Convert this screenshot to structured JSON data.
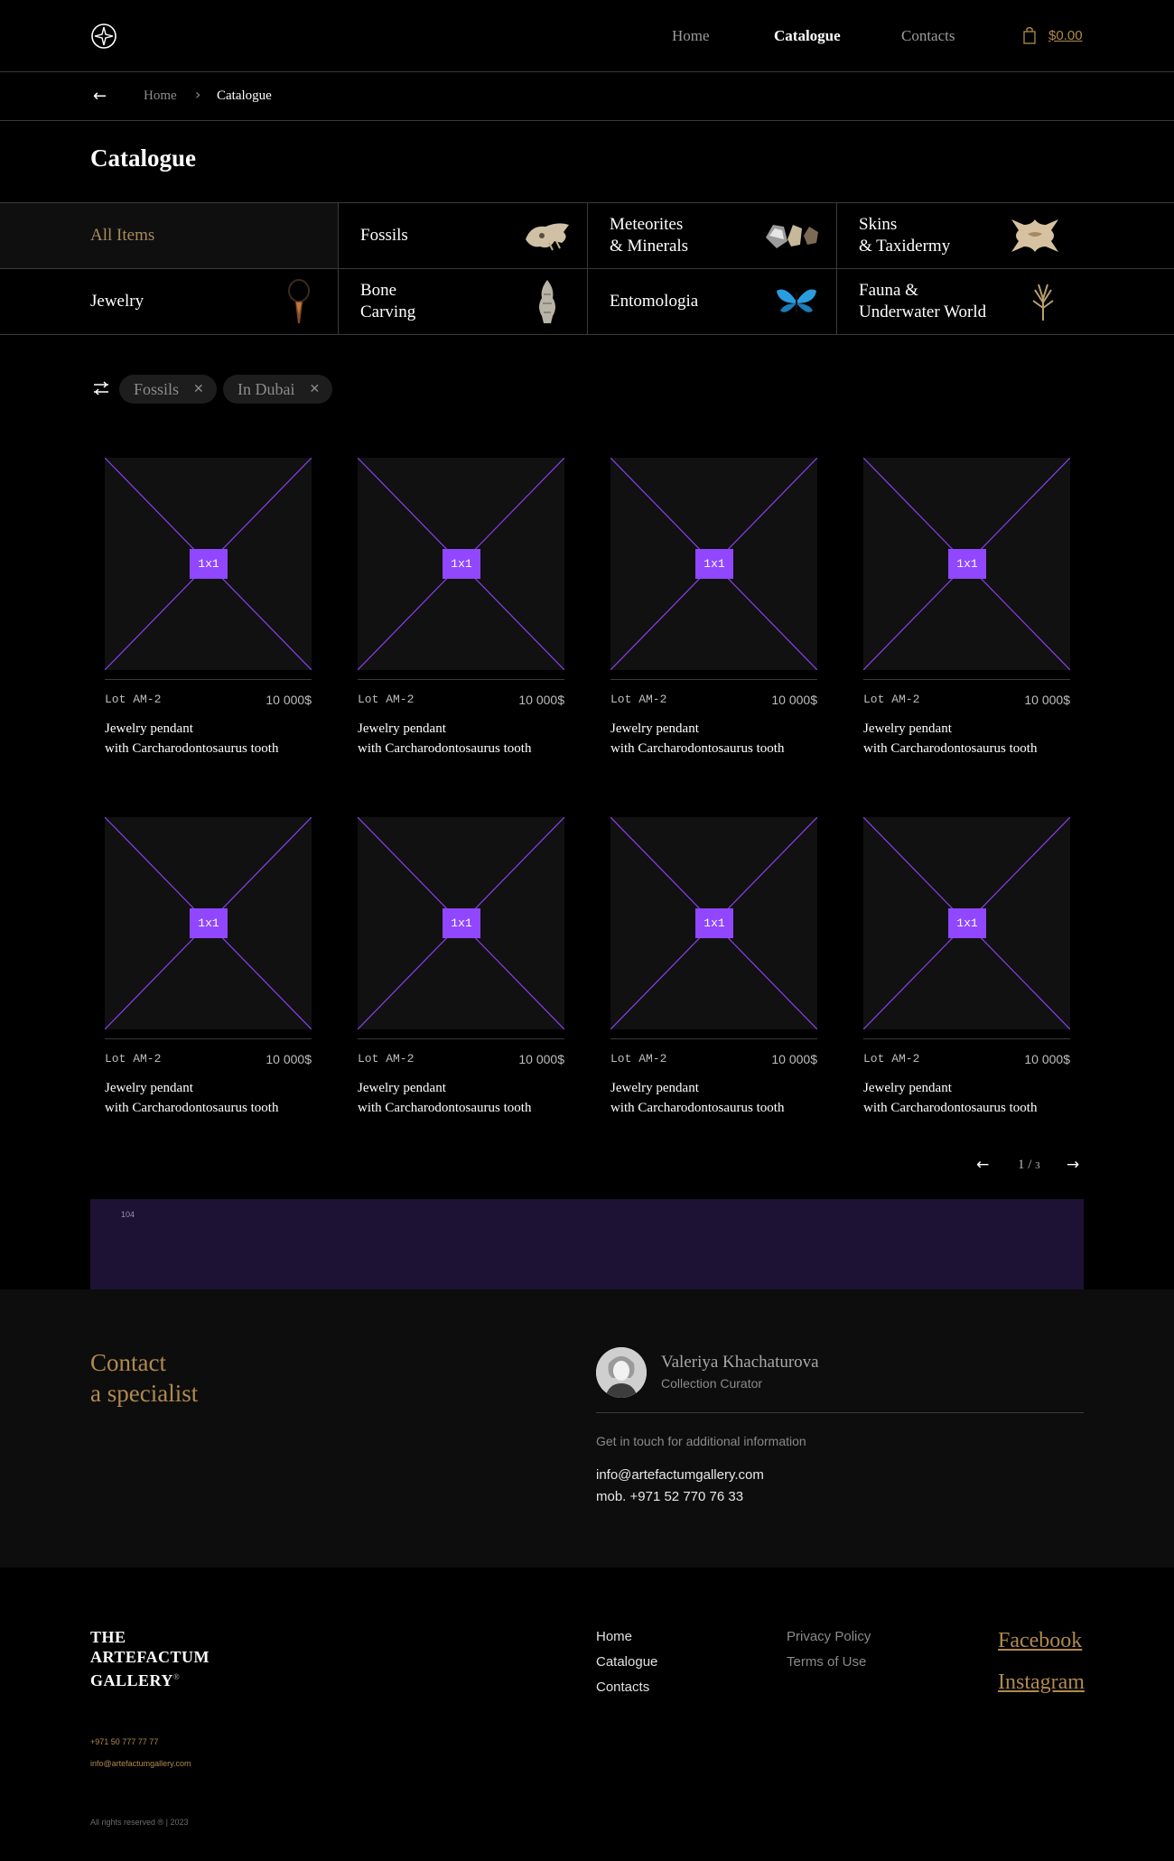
{
  "header": {
    "nav": [
      "Home",
      "Catalogue",
      "Contacts"
    ],
    "active_nav": "Catalogue",
    "cart_total": "$0.00",
    "icons": [
      "logo-compass-icon",
      "cart-icon"
    ]
  },
  "breadcrumb": {
    "home": "Home",
    "current": "Catalogue"
  },
  "page_title": "Catalogue",
  "categories": [
    {
      "label": "All Items",
      "selected": true
    },
    {
      "label": "Fossils"
    },
    {
      "label": "Meteorites\n& Minerals"
    },
    {
      "label": "Skins\n& Taxidermy"
    },
    {
      "label": "Jewelry"
    },
    {
      "label": "Bone\nCarving"
    },
    {
      "label": "Entomologia"
    },
    {
      "label": "Fauna &\nUnderwater World"
    }
  ],
  "filters": {
    "chips": [
      "Fossils",
      "In Dubai"
    ]
  },
  "products": [
    {
      "lot": "Lot AM-2",
      "price": "10 000$",
      "title": "Jewelry pendant\nwith Carcharodontosaurus tooth",
      "placeholder": "1x1"
    },
    {
      "lot": "Lot AM-2",
      "price": "10 000$",
      "title": "Jewelry pendant\nwith Carcharodontosaurus tooth",
      "placeholder": "1x1"
    },
    {
      "lot": "Lot AM-2",
      "price": "10 000$",
      "title": "Jewelry pendant\nwith Carcharodontosaurus tooth",
      "placeholder": "1x1"
    },
    {
      "lot": "Lot AM-2",
      "price": "10 000$",
      "title": "Jewelry pendant\nwith Carcharodontosaurus tooth",
      "placeholder": "1x1"
    },
    {
      "lot": "Lot AM-2",
      "price": "10 000$",
      "title": "Jewelry pendant\nwith Carcharodontosaurus tooth",
      "placeholder": "1x1"
    },
    {
      "lot": "Lot AM-2",
      "price": "10 000$",
      "title": "Jewelry pendant\nwith Carcharodontosaurus tooth",
      "placeholder": "1x1"
    },
    {
      "lot": "Lot AM-2",
      "price": "10 000$",
      "title": "Jewelry pendant\nwith Carcharodontosaurus tooth",
      "placeholder": "1x1"
    },
    {
      "lot": "Lot AM-2",
      "price": "10 000$",
      "title": "Jewelry pendant\nwith Carcharodontosaurus tooth",
      "placeholder": "1x1"
    }
  ],
  "pagination": {
    "current": "1",
    "total": "3"
  },
  "promo": {
    "label": "104"
  },
  "contact": {
    "title": "Contact\na specialist",
    "name": "Valeriya Khachaturova",
    "role": "Collection Curator",
    "note": "Get in touch for additional information",
    "email": "info@artefactumgallery.com",
    "phone": "mob. +971 52 770 76 33"
  },
  "footer": {
    "logo": "THE\nARTEFACTUM\nGALLERY",
    "logo_mark": "®",
    "nav": [
      "Home",
      "Catalogue",
      "Contacts"
    ],
    "legal": [
      "Privacy Policy",
      "Terms of Use"
    ],
    "social": [
      "Facebook",
      "Instagram"
    ],
    "phone": "+971 50 777 77 77",
    "email": "info@artefactumgallery.com",
    "copyright": "All rights reserved ® | 2023"
  },
  "colors": {
    "accent_gold": "#b08a4e",
    "placeholder_purple": "#9147ff",
    "promo_bg": "#1d1233"
  }
}
